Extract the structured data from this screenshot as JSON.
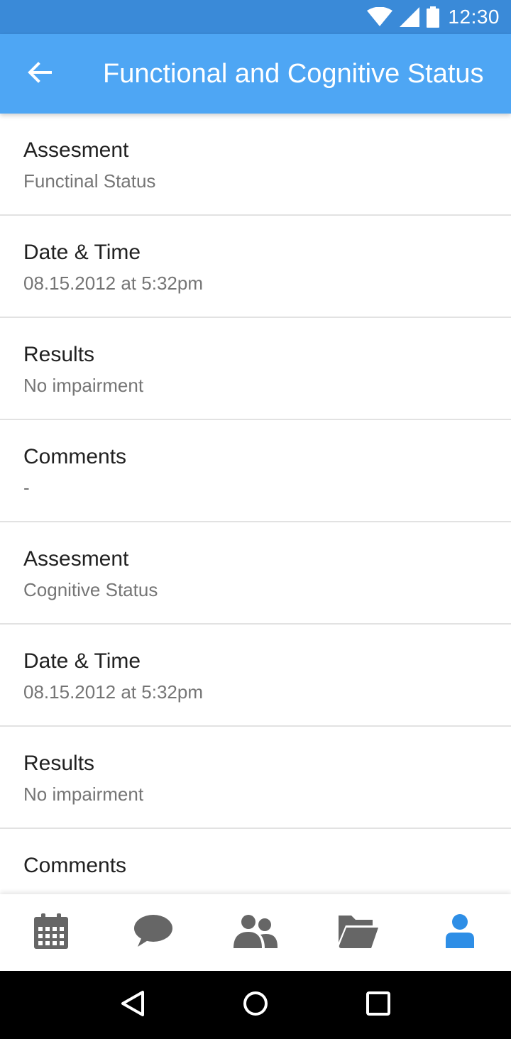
{
  "status_bar": {
    "time": "12:30",
    "icons": [
      "wifi-icon",
      "signal-icon",
      "battery-icon"
    ]
  },
  "app_bar": {
    "back_icon": "arrow-left-icon",
    "title": "Functional and Cognitive Status"
  },
  "list": {
    "items": [
      {
        "label": "Assesment",
        "value": "Functinal Status"
      },
      {
        "label": "Date & Time",
        "value": "08.15.2012 at 5:32pm"
      },
      {
        "label": "Results",
        "value": "No impairment"
      },
      {
        "label": "Comments",
        "value": "-"
      },
      {
        "label": "Assesment",
        "value": "Cognitive Status"
      },
      {
        "label": "Date & Time",
        "value": "08.15.2012 at 5:32pm"
      },
      {
        "label": "Results",
        "value": "No impairment"
      },
      {
        "label": "Comments",
        "value": ""
      }
    ]
  },
  "bottom_nav": {
    "items": [
      {
        "icon": "calendar-icon",
        "active": false
      },
      {
        "icon": "chat-bubble-icon",
        "active": false
      },
      {
        "icon": "people-icon",
        "active": false
      },
      {
        "icon": "folder-icon",
        "active": false
      },
      {
        "icon": "person-icon",
        "active": true
      }
    ]
  },
  "system_nav": {
    "icons": [
      "back-triangle-icon",
      "home-circle-icon",
      "recents-square-icon"
    ]
  },
  "colors": {
    "status_bar": "#3a8ad8",
    "app_bar": "#4ea6f4",
    "nav_inactive": "#666666",
    "nav_active": "#2e8ee6",
    "label": "#212121",
    "value": "#757575"
  }
}
